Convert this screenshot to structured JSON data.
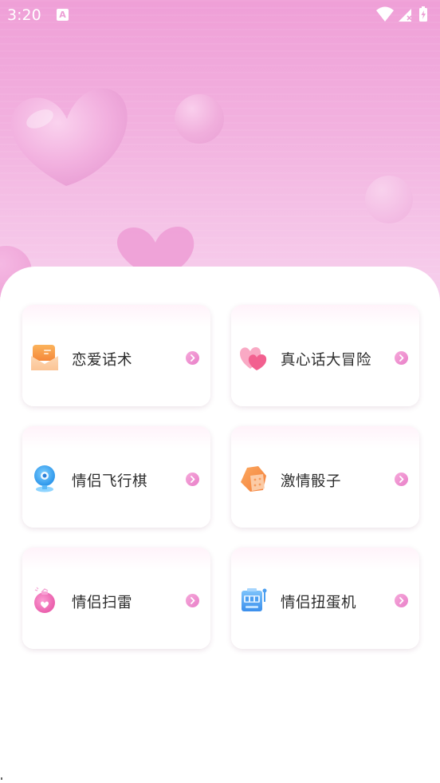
{
  "status_bar": {
    "time": "3:20",
    "notification_icon_letter": "A",
    "icons": [
      "wifi-icon",
      "signal-icon",
      "battery-icon"
    ]
  },
  "hero": {
    "decorations": [
      "heart-balloon",
      "bubble",
      "bubble",
      "heart-balloon"
    ]
  },
  "menu": {
    "items": [
      {
        "label": "恋爱话术",
        "icon": "envelope-icon",
        "accent": "#f7923f"
      },
      {
        "label": "真心话大冒险",
        "icon": "hearts-icon",
        "accent": "#f57fa8"
      },
      {
        "label": "情侣飞行棋",
        "icon": "webcam-icon",
        "accent": "#3ba6f2"
      },
      {
        "label": "激情骰子",
        "icon": "dice-icon",
        "accent": "#f99350"
      },
      {
        "label": "情侣扫雷",
        "icon": "bomb-icon",
        "accent": "#ef6bb4"
      },
      {
        "label": "情侣扭蛋机",
        "icon": "slot-machine-icon",
        "accent": "#4a9ef0"
      }
    ],
    "arrow_icon": "chevron-right-icon"
  },
  "colors": {
    "hero_top": "#ef9fd7",
    "hero_bottom": "#f7d3ee",
    "arrow": "#e87fc8",
    "label": "#2c2c2c"
  }
}
